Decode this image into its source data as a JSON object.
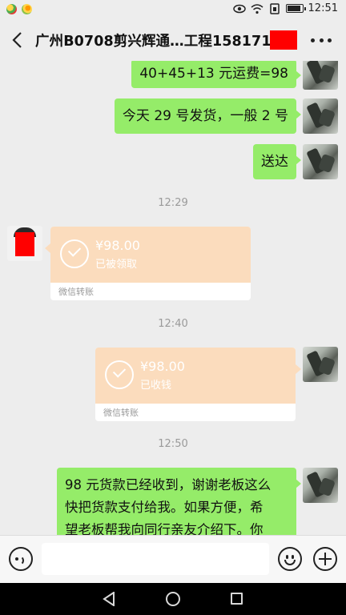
{
  "status_bar": {
    "time": "12:51",
    "icons": [
      "eye-icon",
      "wifi-icon",
      "sim-icon",
      "battery-icon"
    ],
    "battery_level": 0.9
  },
  "header": {
    "title": "广州B0708剪兴辉通…工程15817119",
    "back_icon": "chevron-left-icon",
    "more_icon": "more-dots-icon"
  },
  "messages": [
    {
      "side": "right",
      "type": "text",
      "text": "40+45+13 元运费=98"
    },
    {
      "side": "right",
      "type": "text",
      "text": "今天 29 号发货，一般 2 号"
    },
    {
      "side": "right",
      "type": "text",
      "text": "送达"
    },
    {
      "type": "time",
      "text": "12:29"
    },
    {
      "side": "left",
      "type": "transfer",
      "amount": "¥98.00",
      "status": "已被领取",
      "footer": "微信转账"
    },
    {
      "type": "time",
      "text": "12:40"
    },
    {
      "side": "right",
      "type": "transfer",
      "amount": "¥98.00",
      "status": "已收钱",
      "footer": "微信转账"
    },
    {
      "type": "time",
      "text": "12:50"
    },
    {
      "side": "right",
      "type": "text",
      "lines": [
        "98 元货款已经收到，谢谢老板这么",
        "快把货款支付给我。如果方便，希",
        "望老板帮我向同行亲友介绍下。你"
      ]
    }
  ],
  "input_bar": {
    "placeholder": "",
    "voice_icon": "voice-icon",
    "emoji_icon": "emoji-icon",
    "plus_icon": "plus-icon"
  },
  "colors": {
    "background": "#ededed",
    "bubble_green": "#95ec69",
    "transfer_orange": "#fbdcbd",
    "redaction": "#ff0000"
  }
}
